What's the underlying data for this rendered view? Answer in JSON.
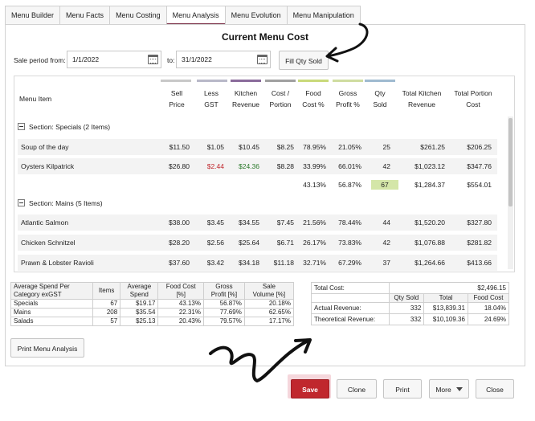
{
  "tabs": [
    {
      "label": "Menu Builder",
      "active": false
    },
    {
      "label": "Menu Facts",
      "active": false
    },
    {
      "label": "Menu Costing",
      "active": false
    },
    {
      "label": "Menu Analysis",
      "active": true
    },
    {
      "label": "Menu Evolution",
      "active": false
    },
    {
      "label": "Menu Manipulation",
      "active": false
    }
  ],
  "page": {
    "title": "Current Menu Cost",
    "sale_period_label": "Sale period from:",
    "from_date": "1/1/2022",
    "to_label": "to:",
    "to_date": "31/1/2022",
    "fill_qty_button": "Fill Qty Sold"
  },
  "grid": {
    "headers": {
      "item": "Menu Item",
      "sell1": "Sell",
      "sell2": "Price",
      "less1": "Less",
      "less2": "GST",
      "kit1": "Kitchen",
      "kit2": "Revenue",
      "cost1": "Cost /",
      "cost2": "Portion",
      "food1": "Food",
      "food2": "Cost %",
      "gross1": "Gross",
      "gross2": "Profit %",
      "qty1": "Qty",
      "qty2": "Sold",
      "tkr1": "Total Kitchen",
      "tkr2": "Revenue",
      "tpc1": "Total Portion",
      "tpc2": "Cost"
    },
    "header_colors": [
      "#c8c8c8",
      "#b8b8c8",
      "#8a6b9b",
      "#a0a0a0",
      "#c9d97a",
      "#cfdca0",
      "#9fbad0"
    ],
    "section_specials": "Section: Specials (2 Items)",
    "specials": [
      {
        "item": "Soup of the day",
        "sell": "$11.50",
        "gst": "$1.05",
        "kitchen": "$10.45",
        "cost": "$8.25",
        "food": "78.95%",
        "gross": "21.05%",
        "qty": "25",
        "tkr": "$261.25",
        "tpc": "$206.25"
      },
      {
        "item": "Oysters Kilpatrick",
        "sell": "$26.80",
        "gst": "$2.44",
        "kitchen": "$24.36",
        "cost": "$8.28",
        "food": "33.99%",
        "gross": "66.01%",
        "qty": "42",
        "tkr": "$1,023.12",
        "tpc": "$347.76"
      }
    ],
    "specials_subtotal": {
      "food": "43.13%",
      "gross": "56.87%",
      "qty": "67",
      "tkr": "$1,284.37",
      "tpc": "$554.01"
    },
    "section_mains": "Section: Mains (5 Items)",
    "mains": [
      {
        "item": "Atlantic Salmon",
        "sell": "$38.00",
        "gst": "$3.45",
        "kitchen": "$34.55",
        "cost": "$7.45",
        "food": "21.56%",
        "gross": "78.44%",
        "qty": "44",
        "tkr": "$1,520.20",
        "tpc": "$327.80"
      },
      {
        "item": "Chicken Schnitzel",
        "sell": "$28.20",
        "gst": "$2.56",
        "kitchen": "$25.64",
        "cost": "$6.71",
        "food": "26.17%",
        "gross": "73.83%",
        "qty": "42",
        "tkr": "$1,076.88",
        "tpc": "$281.82"
      },
      {
        "item": "Prawn & Lobster Ravioli",
        "sell": "$37.60",
        "gst": "$3.42",
        "kitchen": "$34.18",
        "cost": "$11.18",
        "food": "32.71%",
        "gross": "67.29%",
        "qty": "37",
        "tkr": "$1,264.66",
        "tpc": "$413.66"
      }
    ]
  },
  "avg": {
    "h_cat1": "Average Spend Per",
    "h_cat2": "Category exGST",
    "h_items": "Items",
    "h_avg1": "Average",
    "h_avg2": "Spend",
    "h_food1": "Food Cost",
    "h_food2": "[%]",
    "h_gross1": "Gross",
    "h_gross2": "Profit [%]",
    "h_sale1": "Sale",
    "h_sale2": "Volume [%]",
    "rows": [
      {
        "cat": "Specials",
        "items": "67",
        "avg": "$19.17",
        "food": "43.13%",
        "gross": "56.87%",
        "sale": "20.18%"
      },
      {
        "cat": "Mains",
        "items": "208",
        "avg": "$35.54",
        "food": "22.31%",
        "gross": "77.69%",
        "sale": "62.65%"
      },
      {
        "cat": "Salads",
        "items": "57",
        "avg": "$25.13",
        "food": "20.43%",
        "gross": "79.57%",
        "sale": "17.17%"
      }
    ]
  },
  "totals": {
    "total_cost_label": "Total Cost:",
    "total_cost": "$2,496.15",
    "h_qty": "Qty Sold",
    "h_total": "Total",
    "h_food": "Food Cost",
    "actual_label": "Actual Revenue:",
    "actual_qty": "332",
    "actual_total": "$13,839.31",
    "actual_food": "18.04%",
    "theo_label": "Theoretical Revenue:",
    "theo_qty": "332",
    "theo_total": "$10,109.36",
    "theo_food": "24.69%"
  },
  "buttons": {
    "print_analysis": "Print Menu Analysis",
    "save": "Save",
    "clone": "Clone",
    "print": "Print",
    "more": "More",
    "close": "Close"
  },
  "colors": {
    "accent": "#7a2e46",
    "save": "#c0272d",
    "qty_highlight": "#d4e6a8"
  }
}
